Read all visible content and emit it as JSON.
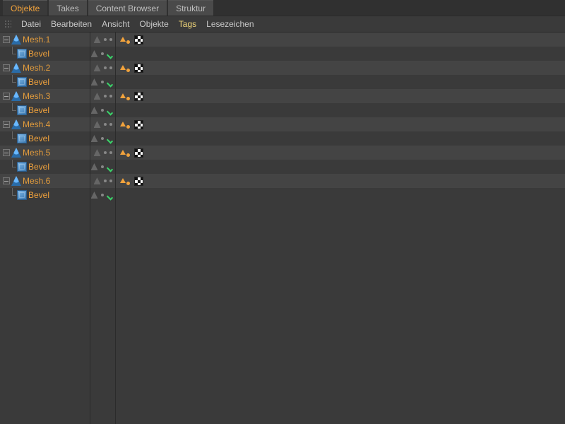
{
  "tabs": [
    {
      "label": "Objekte",
      "active": true
    },
    {
      "label": "Takes",
      "active": false
    },
    {
      "label": "Content Browser",
      "active": false
    },
    {
      "label": "Struktur",
      "active": false
    }
  ],
  "menu": {
    "items": [
      "Datei",
      "Bearbeiten",
      "Ansicht",
      "Objekte",
      "Tags",
      "Lesezeichen"
    ],
    "highlight": "Tags"
  },
  "tree": [
    {
      "name": "Mesh.1",
      "icon": "mesh",
      "tags": [
        "poly",
        "tex"
      ],
      "children": [
        {
          "name": "Bevel",
          "icon": "bevel",
          "enabled": true
        }
      ]
    },
    {
      "name": "Mesh.2",
      "icon": "mesh",
      "tags": [
        "poly",
        "tex"
      ],
      "children": [
        {
          "name": "Bevel",
          "icon": "bevel",
          "enabled": true
        }
      ]
    },
    {
      "name": "Mesh.3",
      "icon": "mesh",
      "tags": [
        "poly",
        "tex"
      ],
      "children": [
        {
          "name": "Bevel",
          "icon": "bevel",
          "enabled": true
        }
      ]
    },
    {
      "name": "Mesh.4",
      "icon": "mesh",
      "tags": [
        "poly",
        "tex"
      ],
      "children": [
        {
          "name": "Bevel",
          "icon": "bevel",
          "enabled": true
        }
      ]
    },
    {
      "name": "Mesh.5",
      "icon": "mesh",
      "tags": [
        "poly",
        "tex"
      ],
      "children": [
        {
          "name": "Bevel",
          "icon": "bevel",
          "enabled": true
        }
      ]
    },
    {
      "name": "Mesh.6",
      "icon": "mesh",
      "tags": [
        "poly",
        "tex"
      ],
      "children": [
        {
          "name": "Bevel",
          "icon": "bevel",
          "enabled": true
        }
      ]
    }
  ],
  "colors": {
    "accent": "#f2a33c",
    "tag_highlight": "#f2d77a",
    "enabled_check": "#3bd46a"
  }
}
